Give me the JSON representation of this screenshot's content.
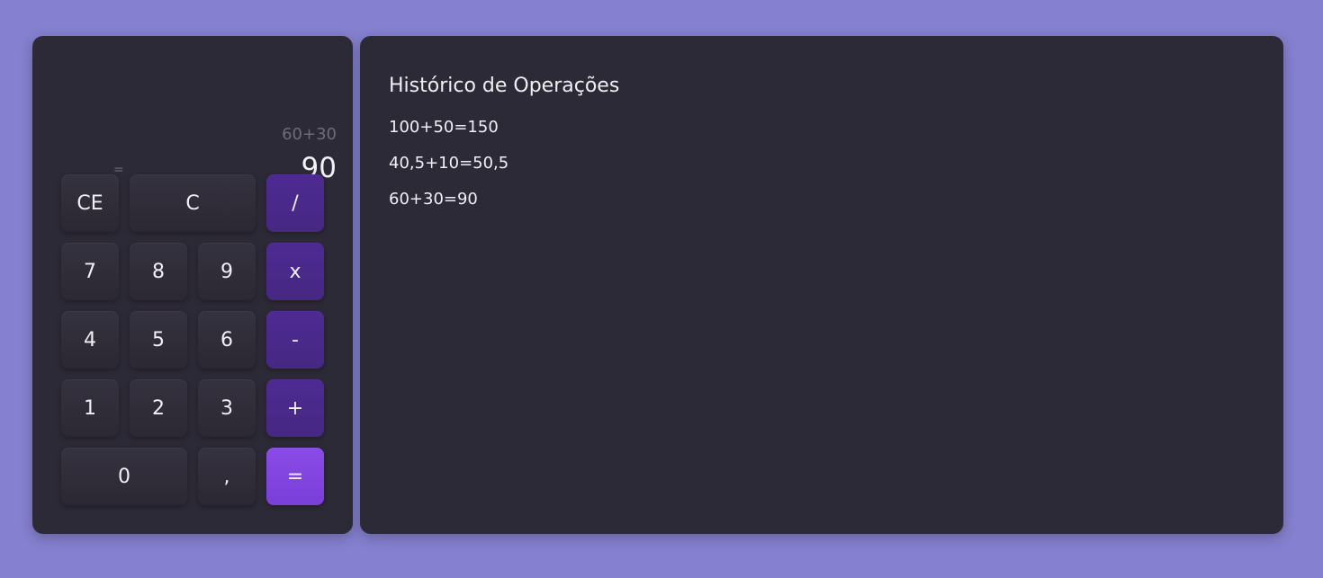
{
  "calculator": {
    "expression": "60+30",
    "equals_hint": "=",
    "result": "90",
    "keys": {
      "ce": "CE",
      "c": "C",
      "divide": "/",
      "seven": "7",
      "eight": "8",
      "nine": "9",
      "multiply": "x",
      "four": "4",
      "five": "5",
      "six": "6",
      "subtract": "-",
      "one": "1",
      "two": "2",
      "three": "3",
      "add": "+",
      "zero": "0",
      "comma": ",",
      "equals": "="
    }
  },
  "history": {
    "title": "Histórico de Operações",
    "items": [
      "100+50=150",
      "40,5+10=50,5",
      "60+30=90"
    ]
  },
  "colors": {
    "background": "#8580cf",
    "panel": "#2d2a37",
    "operator_key": "#4b2a8f",
    "equals_key": "#8448e0"
  }
}
